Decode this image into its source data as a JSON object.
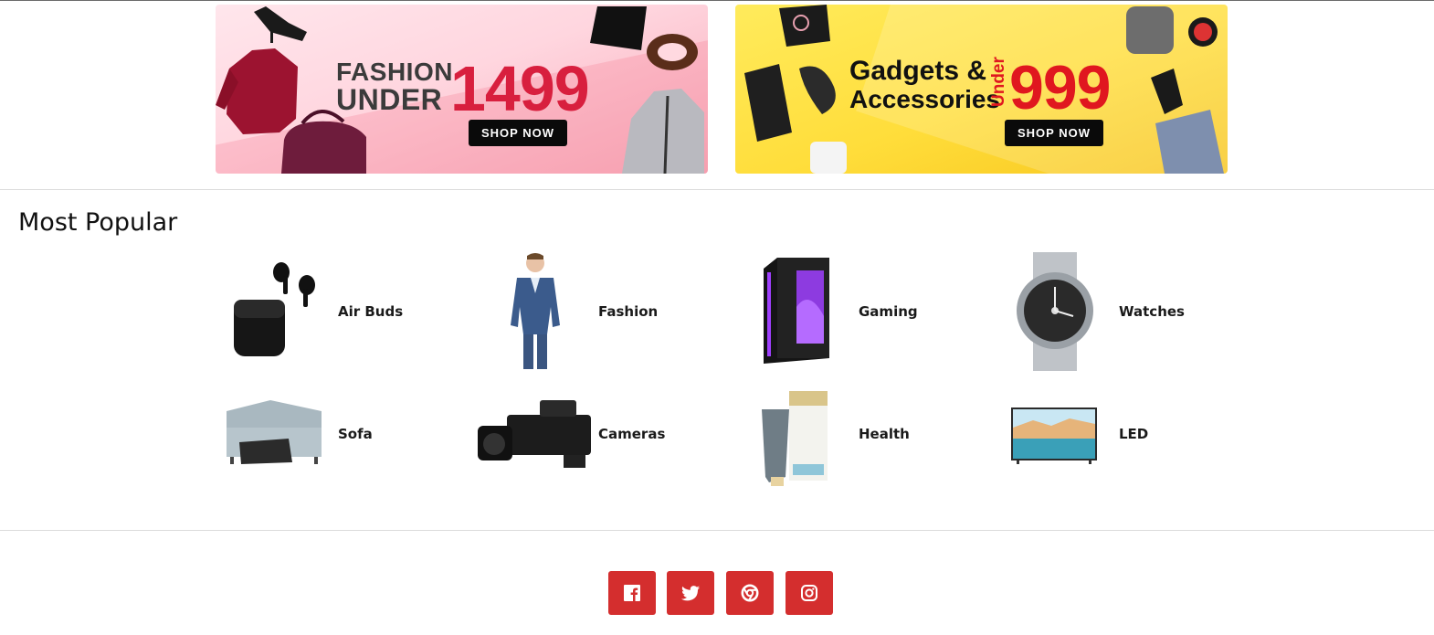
{
  "banners": {
    "fashion": {
      "line1": "FASHION",
      "line2": "UNDER",
      "price": "1499",
      "button": "SHOP NOW"
    },
    "gadgets": {
      "line1": "Gadgets &",
      "line2": "Accessories",
      "under": "Under",
      "price": "999",
      "button": "SHOP NOW"
    }
  },
  "most_popular": {
    "title": "Most Popular",
    "categories": [
      {
        "label": "Air Buds",
        "icon": "airbuds-image"
      },
      {
        "label": "Fashion",
        "icon": "fashion-image"
      },
      {
        "label": "Gaming",
        "icon": "gaming-pc-image"
      },
      {
        "label": "Watches",
        "icon": "watch-image"
      },
      {
        "label": "Sofa",
        "icon": "sofa-image"
      },
      {
        "label": "Cameras",
        "icon": "camera-image"
      },
      {
        "label": "Health",
        "icon": "health-product-image"
      },
      {
        "label": "LED",
        "icon": "led-tv-image"
      }
    ]
  },
  "social": [
    {
      "name": "facebook",
      "icon": "facebook-icon"
    },
    {
      "name": "twitter",
      "icon": "twitter-icon"
    },
    {
      "name": "google",
      "icon": "google-icon"
    },
    {
      "name": "instagram",
      "icon": "instagram-icon"
    }
  ],
  "colors": {
    "social_bg": "#d42e2e",
    "fashion_price": "#d81f3e",
    "gadgets_price": "#e0171f",
    "button_bg": "#0a0a0a"
  }
}
